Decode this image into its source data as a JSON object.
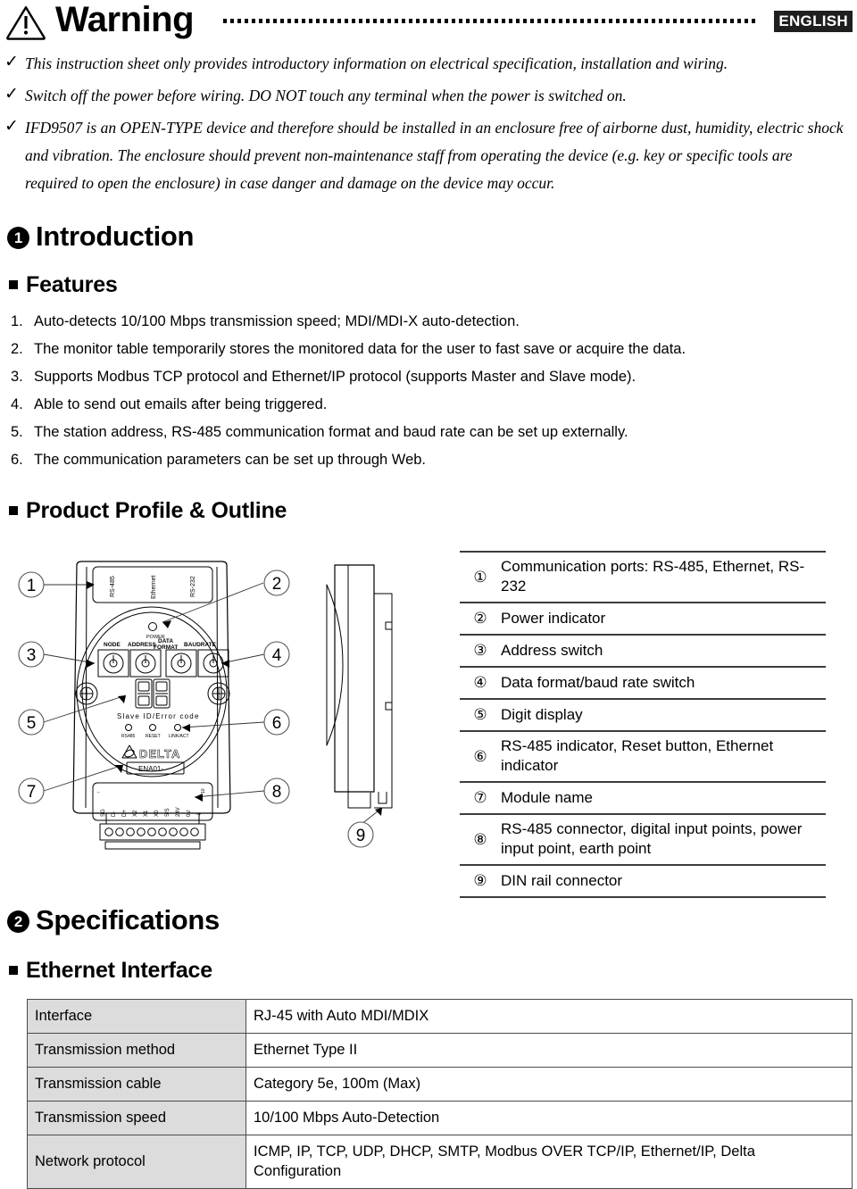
{
  "header": {
    "warning_title": "Warning",
    "language_badge": "ENGLISH",
    "warning_icon": "warning-triangle-icon",
    "dotted_rule": "dotted-leader"
  },
  "warnings": {
    "bullet_glyph": "✓",
    "items": [
      "This instruction sheet only provides introductory information on electrical specification, installation and wiring.",
      "Switch off the power before wiring. DO NOT touch any terminal when the power is switched on.",
      "IFD9507 is an OPEN-TYPE device and therefore should be installed in an enclosure free of airborne dust, humidity, electric shock and vibration. The enclosure should prevent non-maintenance staff from operating the device (e.g. key or specific tools are required to open the enclosure) in case danger and damage on the device may occur."
    ]
  },
  "section_intro": {
    "number": "1",
    "title": "Introduction",
    "features_heading": "Features",
    "features": [
      {
        "num": "1.",
        "text": "Auto-detects 10/100 Mbps transmission speed; MDI/MDI-X auto-detection."
      },
      {
        "num": "2.",
        "text": "The monitor table temporarily stores the monitored data for the user to fast save or acquire the data."
      },
      {
        "num": "3.",
        "text": "Supports Modbus TCP protocol and Ethernet/IP protocol (supports Master and Slave mode)."
      },
      {
        "num": "4.",
        "text": "Able to send out emails after being triggered."
      },
      {
        "num": "5.",
        "text": "The station address, RS-485 communication format and baud rate can be set up externally."
      },
      {
        "num": "6.",
        "text": "The communication parameters can be set up through Web."
      }
    ],
    "profile_heading": "Product Profile & Outline"
  },
  "diagram": {
    "callouts": [
      "1",
      "2",
      "3",
      "4",
      "5",
      "6",
      "7",
      "8",
      "9"
    ],
    "port_labels": [
      "RS-485",
      "Ethernet",
      "RS-232"
    ],
    "power_label": "POWER",
    "switch_labels": [
      "NODE",
      "ADDRESS",
      "DATA\nFORMAT",
      "BAUDRATE"
    ],
    "display_label": "Slave ID/Error code",
    "indicator_labels": [
      "RS485",
      "RESET",
      "LINK/ACT"
    ],
    "brand": "DELTA",
    "module_name": "ENA01-",
    "terminal_labels": [
      "SG",
      "D-",
      "D+",
      "X2",
      "X1",
      "X0",
      "S/S",
      "24V",
      "0V",
      "⏚"
    ]
  },
  "legend": {
    "rows": [
      {
        "num": "①",
        "text": "Communication ports: RS-485, Ethernet, RS-232"
      },
      {
        "num": "②",
        "text": "Power indicator"
      },
      {
        "num": "③",
        "text": "Address switch"
      },
      {
        "num": "④",
        "text": "Data format/baud rate switch"
      },
      {
        "num": "⑤",
        "text": "Digit display"
      },
      {
        "num": "⑥",
        "text": "RS-485 indicator, Reset button, Ethernet indicator"
      },
      {
        "num": "⑦",
        "text": "Module name"
      },
      {
        "num": "⑧",
        "text": "RS-485 connector, digital input points, power input point, earth point"
      },
      {
        "num": "⑨",
        "text": "DIN rail connector"
      }
    ]
  },
  "section_specs": {
    "number": "2",
    "title": "Specifications",
    "subheading": "Ethernet Interface",
    "table": [
      {
        "key": "Interface",
        "value": "RJ-45 with Auto MDI/MDIX"
      },
      {
        "key": "Transmission method",
        "value": "Ethernet Type II"
      },
      {
        "key": "Transmission cable",
        "value": "Category 5e, 100m (Max)"
      },
      {
        "key": "Transmission speed",
        "value": "10/100 Mbps Auto-Detection"
      },
      {
        "key": "Network protocol",
        "value": "ICMP, IP, TCP, UDP, DHCP, SMTP, Modbus OVER TCP/IP, Ethernet/IP, Delta Configuration"
      }
    ]
  },
  "colors": {
    "text": "#000000",
    "badge_bg": "#1f1f1f",
    "badge_text": "#ffffff",
    "table_key_bg": "#dcdcdc",
    "table_border": "#4a4a4a",
    "legend_rule": "#3c3c3c"
  }
}
